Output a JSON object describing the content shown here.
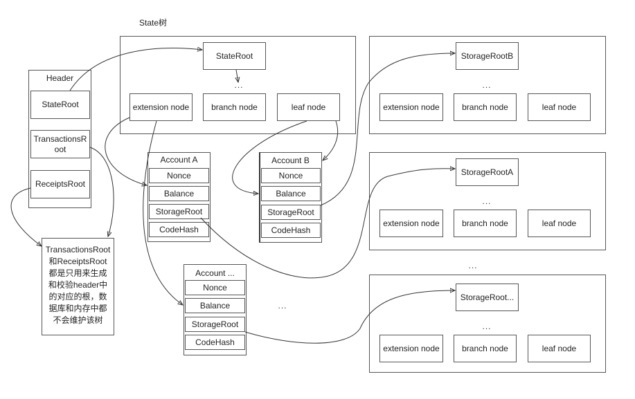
{
  "title": "State树",
  "header": {
    "label": "Header",
    "fields": [
      "StateRoot",
      "TransactionsRoot",
      "ReceiptsRoot"
    ]
  },
  "state_tree": {
    "root": "StateRoot",
    "ellipsis": "...",
    "nodes": [
      "extension node",
      "branch node",
      "leaf node"
    ]
  },
  "accounts": [
    {
      "label": "Account A",
      "fields": [
        "Nonce",
        "Balance",
        "StorageRoot",
        "CodeHash"
      ]
    },
    {
      "label": "Account B",
      "fields": [
        "Nonce",
        "Balance",
        "StorageRoot",
        "CodeHash"
      ]
    },
    {
      "label": "Account ...",
      "fields": [
        "Nonce",
        "Balance",
        "StorageRoot",
        "CodeHash"
      ]
    }
  ],
  "accounts_ellipsis": "...",
  "storage_trees": [
    {
      "root": "StorageRootB",
      "ellipsis": "...",
      "nodes": [
        "extension node",
        "branch node",
        "leaf node"
      ]
    },
    {
      "root": "StorageRootA",
      "ellipsis": "...",
      "nodes": [
        "extension node",
        "branch node",
        "leaf node"
      ]
    },
    {
      "root": "StorageRoot...",
      "ellipsis": "...",
      "nodes": [
        "extension node",
        "branch node",
        "leaf node"
      ]
    }
  ],
  "storage_ellipsis": "...",
  "note": {
    "lines": [
      "TransactionsRoot",
      "和ReceiptsRoot",
      "都是只用来生成",
      "和校验header中",
      "的对应的根，数",
      "据库和内存中都",
      "不会维护该树"
    ]
  }
}
